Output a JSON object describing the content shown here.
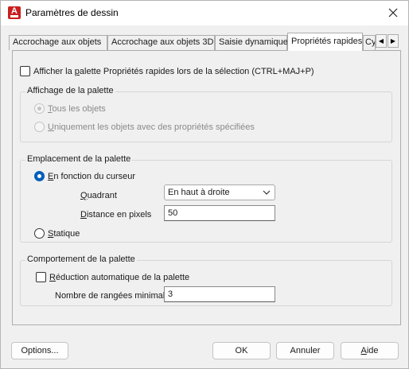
{
  "window": {
    "title": "Paramètres de dessin",
    "app_icon": "autocad-logo-icon",
    "app_icon_letter": "A"
  },
  "tabs": [
    {
      "label": "Accrochage aux objets"
    },
    {
      "label": "Accrochage aux objets 3D"
    },
    {
      "label": "Saisie dynamique"
    },
    {
      "label": "Propriétés rapides",
      "active": true
    },
    {
      "label": "Cy"
    }
  ],
  "tab_scroll": {
    "left": "◀",
    "right": "▶"
  },
  "show_palette": {
    "label_pre": "Afficher la ",
    "label_u": "p",
    "label_post": "alette Propriétés rapides lors de la sélection (CTRL+MAJ+P)",
    "checked": false
  },
  "palette_display": {
    "title": "Affichage de la palette",
    "option_all_u": "T",
    "option_all_rest": "ous les objets",
    "option_specified_u": "U",
    "option_specified_rest": "niquement les objets avec des propriétés spécifiées"
  },
  "palette_location": {
    "title": "Emplacement de la palette",
    "cursor_u": "E",
    "cursor_rest": "n fonction du curseur",
    "quadrant_u": "Q",
    "quadrant_rest": "uadrant",
    "quadrant_value": "En haut à droite",
    "distance_u": "D",
    "distance_rest": "istance en pixels",
    "distance_value": "50",
    "static_u": "S",
    "static_rest": "tatique"
  },
  "palette_behavior": {
    "title": "Comportement de la palette",
    "auto_collapse_u": "R",
    "auto_collapse_rest": "éduction automatique de la palette",
    "min_rows_label": "Nombre de rangées minimal",
    "min_rows_value": "3"
  },
  "buttons": {
    "options": "Options...",
    "ok": "OK",
    "cancel": "Annuler",
    "help_u": "A",
    "help_rest": "ide"
  },
  "colors": {
    "accent": "#005fb8",
    "app_icon": "#c8201f"
  }
}
